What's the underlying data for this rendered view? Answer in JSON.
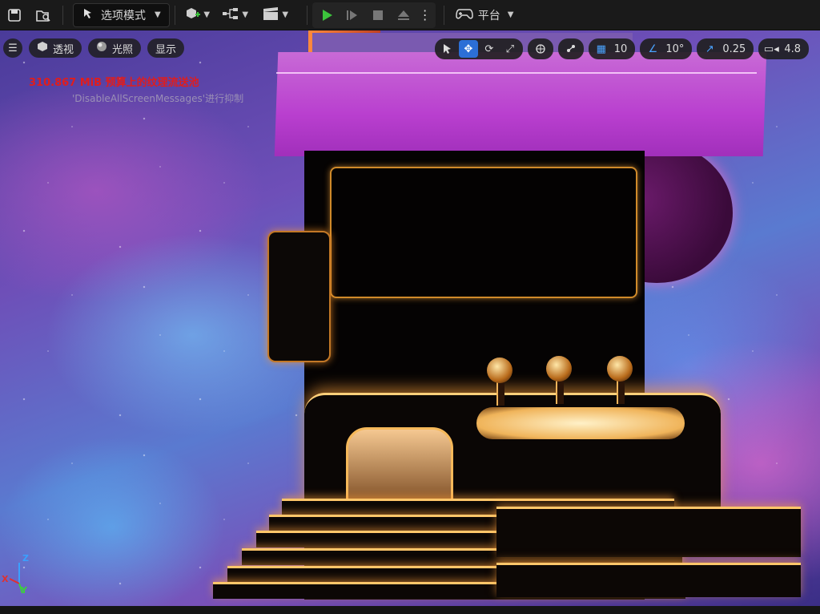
{
  "toolbar": {
    "mode_label": "选项模式",
    "platform_label": "平台",
    "colors": {
      "play": "#3cc43c",
      "bg": "#1a1a1a"
    }
  },
  "viewport": {
    "menu_icon": "hamburger-icon",
    "perspective_label": "透视",
    "lighting_label": "光照",
    "show_label": "显示",
    "grid_snap_value": "10",
    "angle_snap_value": "10°",
    "scale_snap_value": "0.25",
    "camera_speed_value": "4.8",
    "stat_memory": "310.867 MiB 预算上的纹理流送池",
    "stat_hint": "'DisableAllScreenMessages'进行抑制",
    "axis": {
      "x": "X",
      "y": "Y",
      "z": "Z"
    }
  }
}
